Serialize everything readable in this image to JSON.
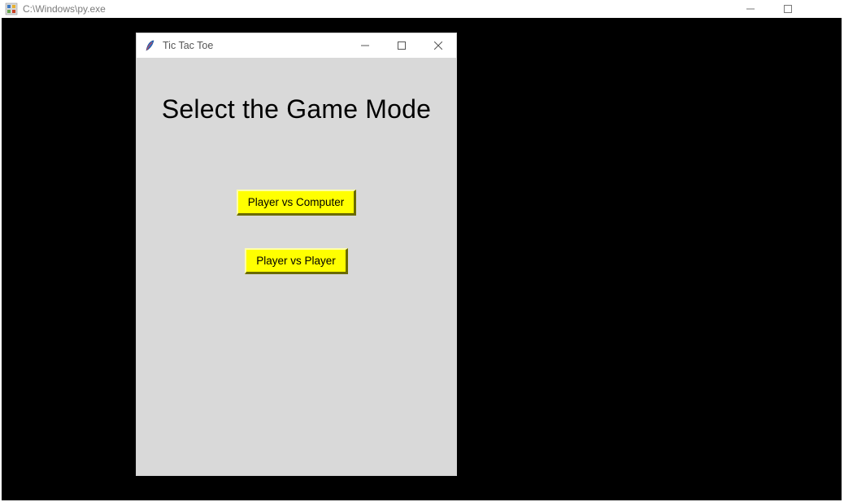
{
  "outer_window": {
    "title": "C:\\Windows\\py.exe"
  },
  "inner_window": {
    "title": "Tic Tac Toe",
    "heading": "Select the Game Mode",
    "buttons": {
      "pvc": "Player vs Computer",
      "pvp": "Player vs Player"
    }
  }
}
